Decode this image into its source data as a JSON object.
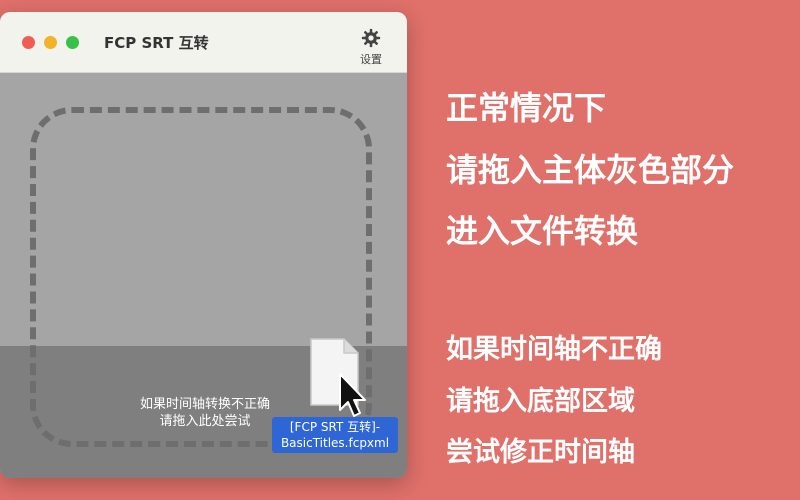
{
  "window": {
    "title": "FCP SRT 互转",
    "settings_label": "设置",
    "hint_lines": [
      "如果时间轴转换不正确",
      "请拖入此处尝试"
    ],
    "drag_label_lines": [
      "[FCP SRT 互转]-",
      "BasicTitles.fcpxml"
    ]
  },
  "right_panel": {
    "group1": [
      "正常情况下",
      "请拖入主体灰色部分",
      "进入文件转换"
    ],
    "group2": [
      "如果时间轴不正确",
      "请拖入底部区域",
      "尝试修正时间轴"
    ]
  },
  "colors": {
    "background": "#e0706a",
    "titlebar": "#f1f3ec",
    "main_zone": "#a5a5a5",
    "bottom_zone": "#7f7f7f",
    "drag_label": "#2f66d6"
  },
  "icons": [
    "gear-icon",
    "document-icon",
    "cursor-arrow-icon"
  ]
}
